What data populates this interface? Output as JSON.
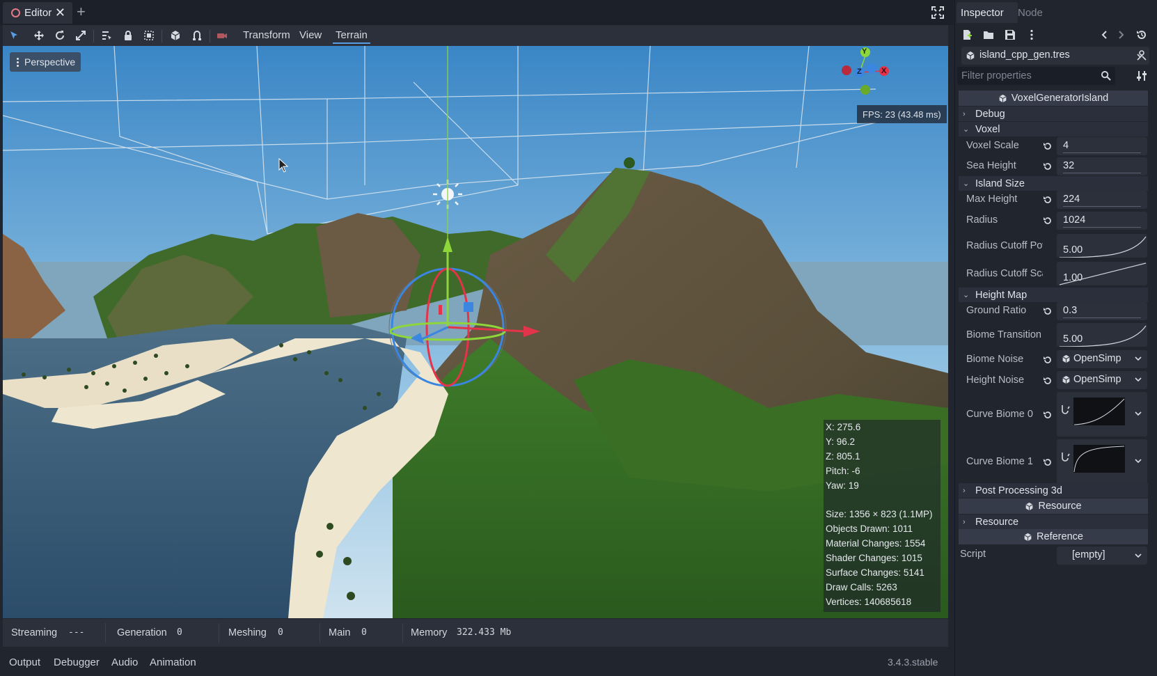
{
  "editor": {
    "tab_label": "Editor",
    "tab_add": "+",
    "toolbar_menus": [
      "Transform",
      "View",
      "Terrain"
    ],
    "active_menu": "Terrain",
    "viewport": {
      "perspective_label": "Perspective",
      "gizmo_axes": {
        "y": "Y",
        "z": "Z",
        "x": "X"
      },
      "fps": "FPS: 23 (43.48 ms)",
      "stats": [
        "X: 275.6",
        "Y: 96.2",
        "Z: 805.1",
        "Pitch: -6",
        "Yaw: 19",
        "",
        "Size: 1356 × 823 (1.1MP)",
        "Objects Drawn: 1011",
        "Material Changes: 1554",
        "Shader Changes: 1015",
        "Surface Changes: 5141",
        "Draw Calls: 5263",
        "Vertices: 140685618"
      ]
    },
    "status": {
      "streaming_label": "Streaming",
      "streaming_value": "---",
      "generation_label": "Generation",
      "generation_value": "0",
      "meshing_label": "Meshing",
      "meshing_value": "0",
      "main_label": "Main",
      "main_value": "0",
      "memory_label": "Memory",
      "memory_value": "322.433 Mb"
    }
  },
  "bottom_panel": {
    "tabs": [
      "Output",
      "Debugger",
      "Audio",
      "Animation"
    ],
    "version": "3.4.3.stable"
  },
  "inspector": {
    "tabs": [
      "Inspector",
      "Node"
    ],
    "resource_name": "island_cpp_gen.tres",
    "filter_placeholder": "Filter properties",
    "class_header": "VoxelGeneratorIsland",
    "sections": {
      "debug": "Debug",
      "voxel": "Voxel",
      "island_size": "Island Size",
      "height_map": "Height Map",
      "post_processing": "Post Processing 3d",
      "resource_header": "Resource",
      "resource": "Resource",
      "reference_header": "Reference"
    },
    "props": {
      "voxel_scale": {
        "label": "Voxel Scale",
        "value": "4"
      },
      "sea_height": {
        "label": "Sea Height",
        "value": "32"
      },
      "max_height": {
        "label": "Max Height",
        "value": "224"
      },
      "radius": {
        "label": "Radius",
        "value": "1024"
      },
      "radius_cutoff_pow": {
        "label": "Radius Cutoff Pow",
        "value": "5.00"
      },
      "radius_cutoff_scale": {
        "label": "Radius Cutoff Scal",
        "value": "1.00"
      },
      "ground_ratio": {
        "label": "Ground Ratio",
        "value": "0.3"
      },
      "biome_transition": {
        "label": "Biome Transition",
        "value": "5.00"
      },
      "biome_noise": {
        "label": "Biome Noise",
        "value": "OpenSimp"
      },
      "height_noise": {
        "label": "Height Noise",
        "value": "OpenSimp"
      },
      "curve_biome_0": {
        "label": "Curve Biome 0"
      },
      "curve_biome_1": {
        "label": "Curve Biome 1"
      },
      "script": {
        "label": "Script",
        "value": "[empty]"
      }
    }
  },
  "colors": {
    "accent": "#5a9de6",
    "panel_bg": "#21262e",
    "field_bg": "#2b303b",
    "axis_x": "#e3344a",
    "axis_y": "#8ed63a",
    "axis_z": "#3a86e0"
  }
}
